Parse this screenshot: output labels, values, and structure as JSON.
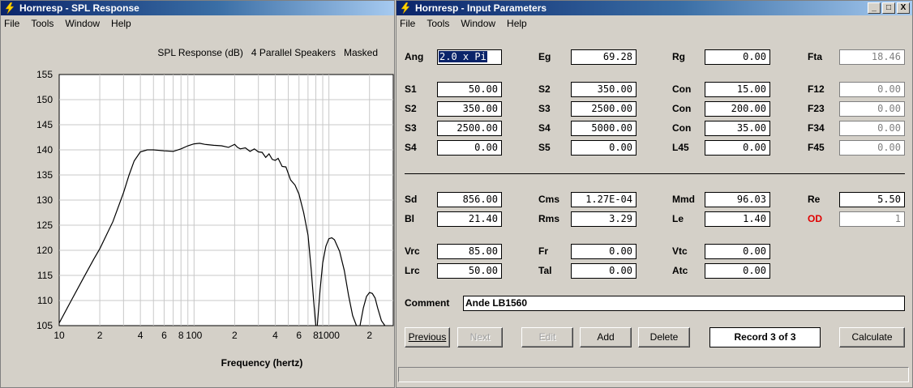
{
  "spl_window": {
    "title": "Hornresp - SPL Response",
    "menu": [
      "File",
      "Tools",
      "Window",
      "Help"
    ]
  },
  "input_window": {
    "title": "Hornresp - Input Parameters",
    "menu": [
      "File",
      "Tools",
      "Window",
      "Help"
    ],
    "controls": {
      "minimize": "_",
      "maximize": "□",
      "close": "X"
    }
  },
  "chart_data": {
    "type": "line",
    "title": "SPL Response (dB)   4 Parallel Speakers   Masked",
    "xlabel": "Frequency (hertz)",
    "x_scale": "log",
    "xlim": [
      10,
      3000
    ],
    "ylim": [
      105,
      155
    ],
    "grid": true,
    "y_ticks": [
      105,
      110,
      115,
      120,
      125,
      130,
      135,
      140,
      145,
      150,
      155
    ],
    "x_tick_labels": [
      {
        "value": 10,
        "label": "10"
      },
      {
        "value": 20,
        "label": "2"
      },
      {
        "value": 40,
        "label": "4"
      },
      {
        "value": 60,
        "label": "6"
      },
      {
        "value": 80,
        "label": "8"
      },
      {
        "value": 100,
        "label": "100"
      },
      {
        "value": 200,
        "label": "2"
      },
      {
        "value": 400,
        "label": "4"
      },
      {
        "value": 600,
        "label": "6"
      },
      {
        "value": 800,
        "label": "8"
      },
      {
        "value": 1000,
        "label": "1000"
      },
      {
        "value": 2000,
        "label": "2"
      }
    ],
    "series": [
      {
        "color": "#000000",
        "segments": [
          {
            "x": [
              10,
              12,
              15,
              18,
              20,
              25,
              30,
              33,
              36,
              40,
              45,
              50,
              60,
              70,
              80,
              90,
              100,
              110,
              120,
              140,
              160,
              180,
              190,
              200,
              210,
              220,
              240,
              260,
              280,
              300,
              320,
              340,
              360,
              380,
              400,
              420,
              450,
              480,
              520,
              560,
              600,
              650,
              700,
              740,
              770,
              790,
              800
            ],
            "y": [
              105.5,
              109.5,
              114.3,
              118.2,
              120.3,
              125.7,
              131.5,
              135,
              137.8,
              139.6,
              140,
              140,
              139.8,
              139.7,
              140.2,
              140.8,
              141.2,
              141.3,
              141.1,
              140.9,
              140.8,
              140.5,
              140.8,
              141.1,
              140.5,
              140.2,
              140.4,
              139.7,
              140.2,
              139.6,
              139.5,
              138.5,
              139.2,
              138.1,
              137.9,
              138.3,
              136.7,
              136.6,
              134,
              133,
              131.2,
              127.5,
              123,
              116,
              110,
              106.5,
              105
            ]
          },
          {
            "x": [
              820,
              860,
              900,
              950,
              1000,
              1050,
              1100,
              1200,
              1300,
              1400,
              1500,
              1600
            ],
            "y": [
              105,
              112,
              117.5,
              120.8,
              122.3,
              122.5,
              122.1,
              119.8,
              116,
              111,
              107,
              105
            ]
          },
          {
            "x": [
              1700,
              1800,
              1900,
              2000,
              2100,
              2200,
              2300,
              2450,
              2600
            ],
            "y": [
              105,
              108.5,
              110.8,
              111.6,
              111.4,
              110.5,
              108.5,
              106,
              105
            ]
          }
        ]
      }
    ]
  },
  "params": {
    "ang": "2.0 x Pi",
    "eg": "69.28",
    "rg": "0.00",
    "fta": "18.46",
    "s1": "50.00",
    "s2a": "350.00",
    "s2b": "350.00",
    "s3a": "2500.00",
    "s3b": "2500.00",
    "s4a": "0.00",
    "s4b": "5000.00",
    "s5": "0.00",
    "con1": "15.00",
    "con2": "200.00",
    "con3": "35.00",
    "l45": "0.00",
    "f12": "0.00",
    "f23": "0.00",
    "f34": "0.00",
    "f45": "0.00",
    "sd": "856.00",
    "bl": "21.40",
    "cms": "1.27E-04",
    "rms": "3.29",
    "mmd": "96.03",
    "le": "1.40",
    "re": "5.50",
    "od": "1",
    "vrc": "85.00",
    "lrc": "50.00",
    "fr": "0.00",
    "tal": "0.00",
    "vtc": "0.00",
    "atc": "0.00",
    "comment": "Ande LB1560"
  },
  "labels": {
    "ang": "Ang",
    "eg": "Eg",
    "rg": "Rg",
    "fta": "Fta",
    "s1": "S1",
    "s2": "S2",
    "s3": "S3",
    "s4": "S4",
    "s5": "S5",
    "con": "Con",
    "l45": "L45",
    "f12": "F12",
    "f23": "F23",
    "f34": "F34",
    "f45": "F45",
    "sd": "Sd",
    "bl": "Bl",
    "cms": "Cms",
    "rms": "Rms",
    "mmd": "Mmd",
    "le": "Le",
    "re": "Re",
    "od": "OD",
    "vrc": "Vrc",
    "lrc": "Lrc",
    "fr": "Fr",
    "tal": "Tal",
    "vtc": "Vtc",
    "atc": "Atc",
    "comment": "Comment"
  },
  "buttons": {
    "previous": "Previous",
    "next": "Next",
    "edit": "Edit",
    "add": "Add",
    "delete": "Delete",
    "calculate": "Calculate"
  },
  "record": "Record 3 of 3",
  "colors": {
    "title_start": "#0a246a",
    "title_end": "#a6caf0",
    "od_label": "#e00000",
    "window_bg": "#d4d0c8"
  }
}
